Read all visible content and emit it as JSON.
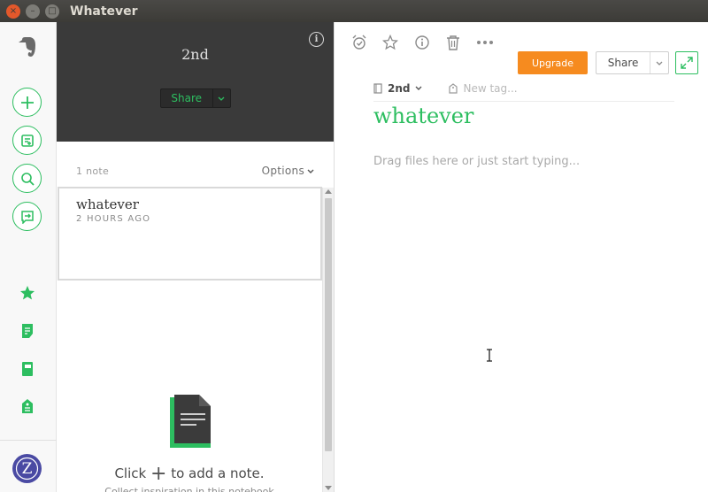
{
  "window": {
    "title": "Whatever",
    "controls": {
      "close": "×",
      "minimize": "–",
      "maximize": "□"
    }
  },
  "sidebar": {
    "buttons": [
      {
        "name": "evernote-logo-icon"
      },
      {
        "name": "new-note",
        "icon": "plus-icon"
      },
      {
        "name": "new-notebook",
        "icon": "note-add-icon"
      },
      {
        "name": "search",
        "icon": "search-icon"
      },
      {
        "name": "work-chat",
        "icon": "chat-icon"
      },
      {
        "name": "shortcuts",
        "icon": "star-icon"
      },
      {
        "name": "notes",
        "icon": "notes-icon"
      },
      {
        "name": "notebooks",
        "icon": "notebook-icon"
      },
      {
        "name": "tags",
        "icon": "tag-icon"
      }
    ],
    "avatar_letter": "Z"
  },
  "notebook": {
    "title": "2nd",
    "info_icon": "i",
    "share_label": "Share"
  },
  "note_list": {
    "count_label": "1 note",
    "options_label": "Options",
    "notes": [
      {
        "title": "whatever",
        "time": "2 HOURS AGO"
      }
    ],
    "empty_state": {
      "text_before": "Click",
      "plus": "+",
      "text_after": "to add a note.",
      "subtext": "Collect inspiration in this notebook"
    }
  },
  "editor": {
    "toolbar_icons": [
      "reminder-icon",
      "favorite-star-icon",
      "info-icon",
      "trash-icon",
      "more-icon"
    ],
    "upgrade_label": "Upgrade",
    "share_label": "Share",
    "notebook_name": "2nd",
    "tag_placeholder": "New tag...",
    "note_title": "whatever",
    "body_placeholder": "Drag files here or just start typing..."
  },
  "colors": {
    "accent": "#2dbe60",
    "upgrade": "#f68b1f",
    "header_dark": "#3a3a3a"
  }
}
